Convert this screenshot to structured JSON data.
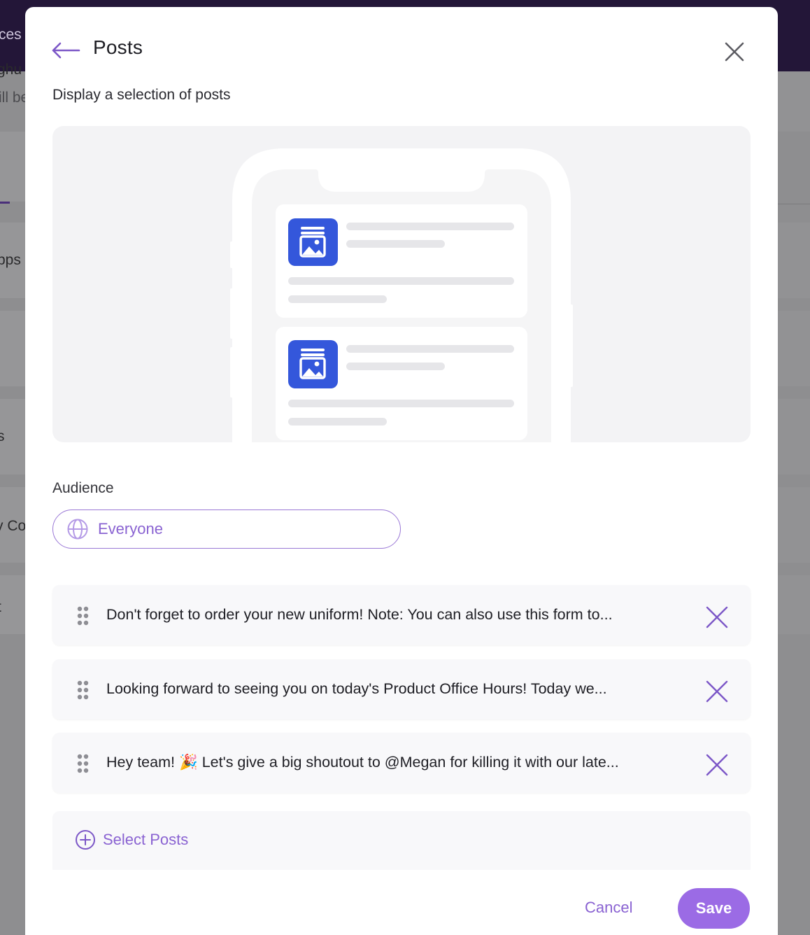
{
  "background": {
    "fragments": [
      "ces",
      "ghu",
      "ill be",
      "pps",
      "s",
      "y Co",
      "t"
    ]
  },
  "modal": {
    "title": "Posts",
    "subtitle": "Display a selection of posts",
    "audience": {
      "label": "Audience",
      "value": "Everyone",
      "icon": "globe-icon"
    },
    "posts": [
      {
        "text": "Don't forget to order your new uniform! Note: You can also use this form to..."
      },
      {
        "text": "Looking forward to seeing you on today's Product Office Hours! Today we..."
      },
      {
        "text": "Hey team! 🎉 Let's give a big shoutout to @Megan for killing it with our late..."
      }
    ],
    "select_posts_label": "Select Posts",
    "cancel_label": "Cancel",
    "save_label": "Save"
  },
  "colors": {
    "accent": "#8a63d2",
    "save": "#9b6be5",
    "header_dark": "#231638",
    "post_icon": "#3457db"
  }
}
